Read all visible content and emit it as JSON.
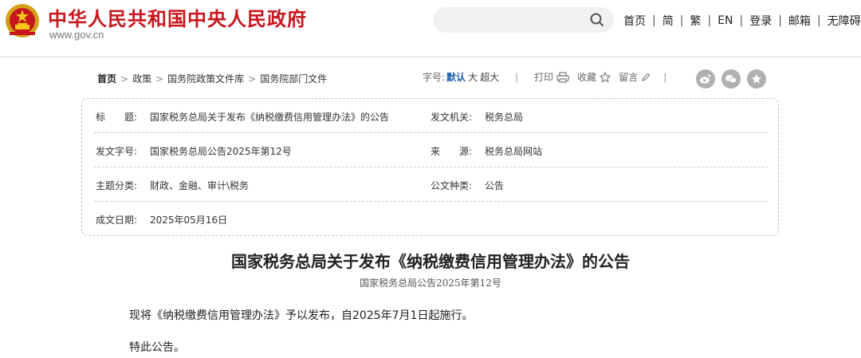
{
  "header": {
    "site_title": "中华人民共和国中央人民政府",
    "site_url": "www.gov.cn",
    "search_placeholder": "",
    "nav": [
      "首页",
      "简",
      "繁",
      "EN",
      "登录",
      "邮箱",
      "无障碍"
    ]
  },
  "breadcrumb": {
    "items": [
      "首页",
      "政策",
      "国务院政策文件库",
      "国务院部门文件"
    ]
  },
  "toolbar": {
    "font_label": "字号:",
    "font_default": "默认",
    "font_large": "大",
    "font_xlarge": "超大",
    "print": "打印",
    "favorite": "收藏",
    "comment": "留言"
  },
  "share": {
    "icons": [
      "weibo-icon",
      "wechat-icon",
      "favorite-star-icon"
    ]
  },
  "info": {
    "title_label": "标　　题:",
    "title_value": "国家税务总局关于发布《纳税缴费信用管理办法》的公告",
    "issuer_label": "发文机关:",
    "issuer_value": "税务总局",
    "docno_label": "发文字号:",
    "docno_value": "国家税务总局公告2025年第12号",
    "source_label": "来　　源:",
    "source_value": "税务总局网站",
    "topic_label": "主题分类:",
    "topic_value": "财政、金融、审计\\税务",
    "type_label": "公文种类:",
    "type_value": "公告",
    "date_label": "成文日期:",
    "date_value": "2025年05月16日"
  },
  "article": {
    "title": "国家税务总局关于发布《纳税缴费信用管理办法》的公告",
    "subtitle": "国家税务总局公告2025年第12号",
    "para1": "现将《纳税缴费信用管理办法》予以发布，自2025年7月1日起施行。",
    "para2": "特此公告。"
  },
  "colors": {
    "brand_red": "#c8161d",
    "accent_blue": "#1a5ea8"
  }
}
